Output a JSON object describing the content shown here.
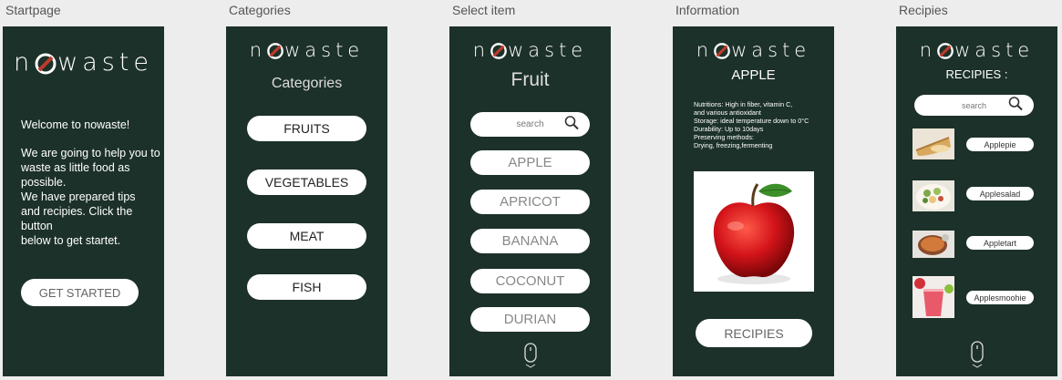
{
  "frames": [
    {
      "label": "Startpage"
    },
    {
      "label": "Categories"
    },
    {
      "label": "Select item"
    },
    {
      "label": "Information"
    },
    {
      "label": "Recipies"
    }
  ],
  "logo": {
    "prefix": "n",
    "suffix": "waste"
  },
  "startpage": {
    "welcome": "Welcome to nowaste!",
    "intro_lines": [
      "We are going to help you to",
      "waste as little food as",
      "possible.",
      "We have prepared tips",
      "and recipies. Click the button",
      "below to get startet."
    ],
    "button": "GET STARTED"
  },
  "categories": {
    "title": "Categories",
    "items": [
      "FRUITS",
      "VEGETABLES",
      "MEAT",
      "FISH"
    ]
  },
  "select_item": {
    "title": "Fruit",
    "search_placeholder": "search",
    "items": [
      "APPLE",
      "APRICOT",
      "BANANA",
      "COCONUT",
      "DURIAN"
    ]
  },
  "information": {
    "title": "APPLE",
    "details": [
      "Nutritions:  High in fiber, vitamin C,",
      "and various antioxidant",
      "Storage: ideal temperature down to 0°C",
      "Durability: Up to 10days",
      "Preserving methods:",
      "Drying, freezing,fermenting"
    ],
    "button": "RECIPIES"
  },
  "recipies": {
    "title": "RECIPIES :",
    "search_placeholder": "search",
    "items": [
      "Applepie",
      "Applesalad",
      "Appletart",
      "Applesmoohie"
    ]
  },
  "colors": {
    "screen_bg": "#1c3129",
    "logo_slash": "#c0392b",
    "pill_bg": "#ffffff"
  }
}
